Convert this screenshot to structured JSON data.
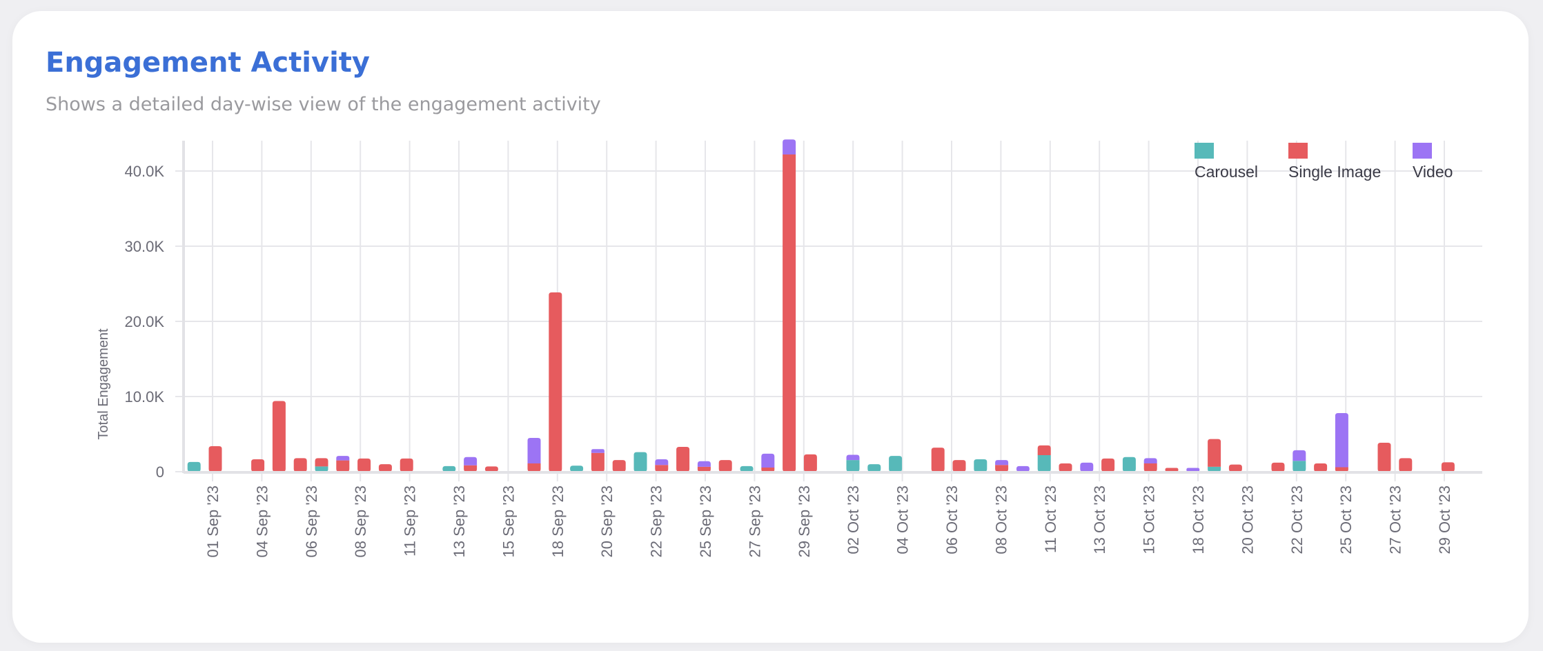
{
  "card": {
    "title": "Engagement Activity",
    "subtitle": "Shows a detailed day-wise view of the engagement activity"
  },
  "chart_data": {
    "type": "bar",
    "stacked": true,
    "title": "Engagement Activity",
    "subtitle": "Shows a detailed day-wise view of the engagement activity",
    "xlabel": "",
    "ylabel": "Total Engagement",
    "ylim": [
      0,
      44000
    ],
    "y_ticks": [
      0,
      10000,
      20000,
      30000,
      40000
    ],
    "y_tick_labels": [
      "0",
      "10.0K",
      "20.0K",
      "30.0K",
      "40.0K"
    ],
    "x_axis_type": "time",
    "x_range": [
      "31 Aug '23",
      "29 Oct '23"
    ],
    "x_tick_labels": [
      "01 Sep '23",
      "04 Sep '23",
      "06 Sep '23",
      "08 Sep '23",
      "11 Sep '23",
      "13 Sep '23",
      "15 Sep '23",
      "18 Sep '23",
      "20 Sep '23",
      "22 Sep '23",
      "25 Sep '23",
      "27 Sep '23",
      "29 Sep '23",
      "02 Oct '23",
      "04 Oct '23",
      "06 Oct '23",
      "08 Oct '23",
      "11 Oct '23",
      "13 Oct '23",
      "15 Oct '23",
      "18 Oct '23",
      "20 Oct '23",
      "22 Oct '23",
      "25 Oct '23",
      "27 Oct '23",
      "29 Oct '23"
    ],
    "grid": true,
    "legend": "top-right",
    "series": [
      {
        "name": "Carousel",
        "color": "#57b9b9"
      },
      {
        "name": "Single Image",
        "color": "#e65b5e"
      },
      {
        "name": "Video",
        "color": "#9c74f4"
      }
    ],
    "days": [
      {
        "day": -1,
        "date": "31 Aug '23",
        "values": [
          1300,
          0,
          0
        ]
      },
      {
        "day": 0,
        "date": "01 Sep '23",
        "values": [
          0,
          3400,
          0
        ]
      },
      {
        "day": 2,
        "date": "03 Sep '23",
        "values": [
          0,
          1650,
          0
        ]
      },
      {
        "day": 3,
        "date": "04 Sep '23",
        "values": [
          0,
          9400,
          0
        ]
      },
      {
        "day": 4,
        "date": "05 Sep '23",
        "values": [
          0,
          1800,
          0
        ]
      },
      {
        "day": 5,
        "date": "06 Sep '23",
        "values": [
          700,
          1100,
          0
        ]
      },
      {
        "day": 6,
        "date": "07 Sep '23",
        "values": [
          0,
          1500,
          600
        ]
      },
      {
        "day": 7,
        "date": "08 Sep '23",
        "values": [
          0,
          1750,
          0
        ]
      },
      {
        "day": 8,
        "date": "09 Sep '23",
        "values": [
          0,
          1000,
          0
        ]
      },
      {
        "day": 9,
        "date": "10 Sep '23",
        "values": [
          0,
          1750,
          0
        ]
      },
      {
        "day": 11,
        "date": "12 Sep '23",
        "values": [
          750,
          0,
          0
        ]
      },
      {
        "day": 12,
        "date": "13 Sep '23",
        "values": [
          0,
          850,
          1100
        ]
      },
      {
        "day": 13,
        "date": "14 Sep '23",
        "values": [
          0,
          700,
          0
        ]
      },
      {
        "day": 15,
        "date": "16 Sep '23",
        "values": [
          0,
          1100,
          3400
        ]
      },
      {
        "day": 16,
        "date": "17 Sep '23",
        "values": [
          0,
          23850,
          0
        ]
      },
      {
        "day": 17,
        "date": "18 Sep '23",
        "values": [
          800,
          0,
          0
        ]
      },
      {
        "day": 18,
        "date": "19 Sep '23",
        "values": [
          0,
          2500,
          500
        ]
      },
      {
        "day": 19,
        "date": "20 Sep '23",
        "values": [
          0,
          1550,
          0
        ]
      },
      {
        "day": 20,
        "date": "21 Sep '23",
        "values": [
          2600,
          0,
          0
        ]
      },
      {
        "day": 21,
        "date": "22 Sep '23",
        "values": [
          0,
          900,
          750
        ]
      },
      {
        "day": 22,
        "date": "23 Sep '23",
        "values": [
          0,
          3300,
          0
        ]
      },
      {
        "day": 23,
        "date": "24 Sep '23",
        "values": [
          0,
          650,
          750
        ]
      },
      {
        "day": 24,
        "date": "25 Sep '23",
        "values": [
          0,
          1550,
          0
        ]
      },
      {
        "day": 25,
        "date": "26 Sep '23",
        "values": [
          750,
          0,
          0
        ]
      },
      {
        "day": 26,
        "date": "27 Sep '23",
        "values": [
          0,
          550,
          1850
        ]
      },
      {
        "day": 27,
        "date": "28 Sep '23",
        "values": [
          0,
          42200,
          2000
        ]
      },
      {
        "day": 28,
        "date": "29 Sep '23",
        "values": [
          0,
          2300,
          0
        ]
      },
      {
        "day": 30,
        "date": "01 Oct '23",
        "values": [
          1550,
          0,
          700
        ]
      },
      {
        "day": 31,
        "date": "02 Oct '23",
        "values": [
          1000,
          0,
          0
        ]
      },
      {
        "day": 32,
        "date": "03 Oct '23",
        "values": [
          2100,
          0,
          0
        ]
      },
      {
        "day": 34,
        "date": "05 Oct '23",
        "values": [
          0,
          3200,
          0
        ]
      },
      {
        "day": 35,
        "date": "06 Oct '23",
        "values": [
          0,
          1550,
          0
        ]
      },
      {
        "day": 36,
        "date": "07 Oct '23",
        "values": [
          1650,
          0,
          0
        ]
      },
      {
        "day": 37,
        "date": "08 Oct '23",
        "values": [
          0,
          900,
          650
        ]
      },
      {
        "day": 38,
        "date": "09 Oct '23",
        "values": [
          0,
          0,
          750
        ]
      },
      {
        "day": 39,
        "date": "10 Oct '23",
        "values": [
          2200,
          1300,
          0
        ]
      },
      {
        "day": 40,
        "date": "11 Oct '23",
        "values": [
          0,
          1100,
          0
        ]
      },
      {
        "day": 41,
        "date": "12 Oct '23",
        "values": [
          0,
          0,
          1200
        ]
      },
      {
        "day": 42,
        "date": "13 Oct '23",
        "values": [
          0,
          1750,
          0
        ]
      },
      {
        "day": 43,
        "date": "14 Oct '23",
        "values": [
          1950,
          0,
          0
        ]
      },
      {
        "day": 44,
        "date": "15 Oct '23",
        "values": [
          0,
          1100,
          700
        ]
      },
      {
        "day": 45,
        "date": "16 Oct '23",
        "values": [
          0,
          500,
          0
        ]
      },
      {
        "day": 46,
        "date": "17 Oct '23",
        "values": [
          0,
          0,
          500
        ]
      },
      {
        "day": 47,
        "date": "18 Oct '23",
        "values": [
          650,
          3700,
          0
        ]
      },
      {
        "day": 48,
        "date": "19 Oct '23",
        "values": [
          0,
          950,
          0
        ]
      },
      {
        "day": 50,
        "date": "21 Oct '23",
        "values": [
          0,
          1200,
          0
        ]
      },
      {
        "day": 51,
        "date": "22 Oct '23",
        "values": [
          1450,
          0,
          1400
        ]
      },
      {
        "day": 52,
        "date": "23 Oct '23",
        "values": [
          0,
          1100,
          0
        ]
      },
      {
        "day": 53,
        "date": "24 Oct '23",
        "values": [
          0,
          600,
          7200
        ]
      },
      {
        "day": 55,
        "date": "26 Oct '23",
        "values": [
          0,
          3850,
          0
        ]
      },
      {
        "day": 56,
        "date": "27 Oct '23",
        "values": [
          0,
          1800,
          0
        ]
      },
      {
        "day": 58,
        "date": "29 Oct '23",
        "values": [
          0,
          1250,
          0
        ]
      }
    ]
  }
}
